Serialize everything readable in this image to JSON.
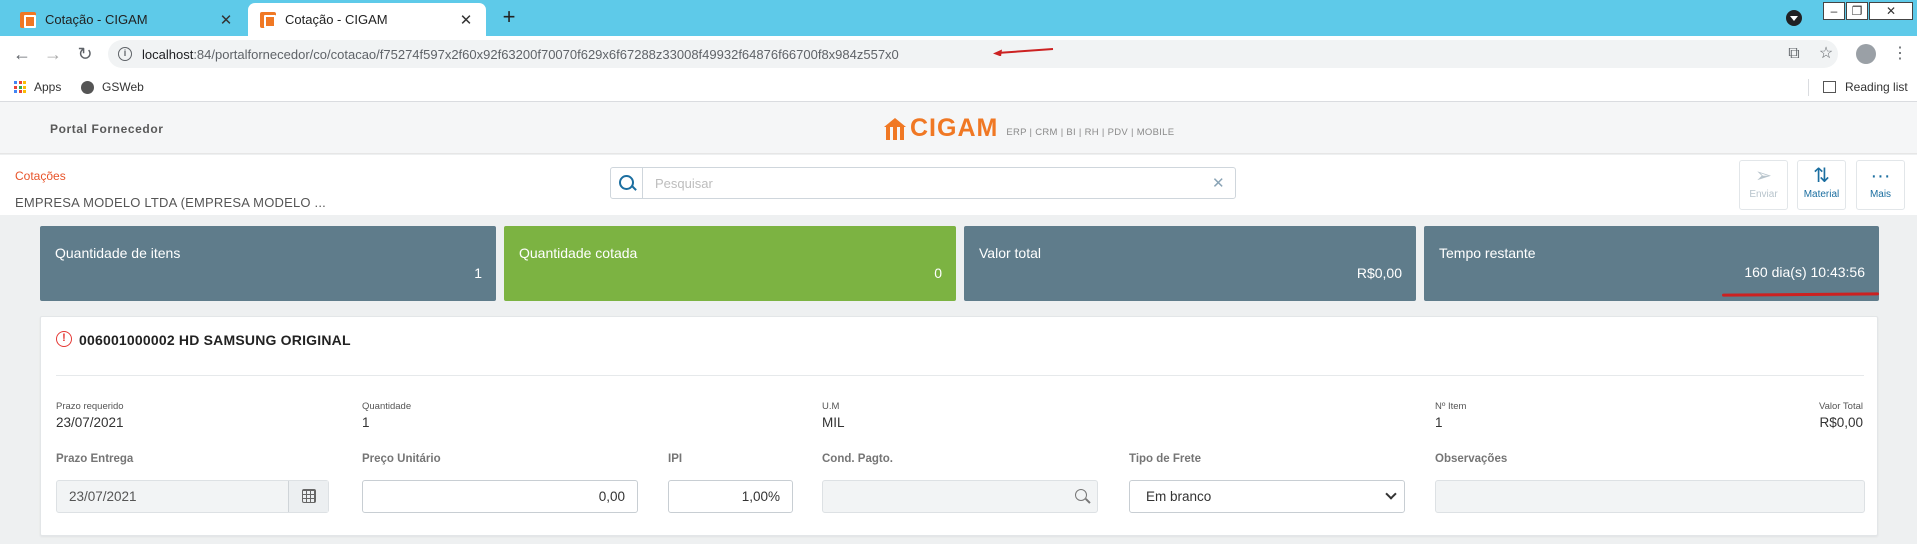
{
  "browser": {
    "tabs": [
      {
        "title": "Cotação - CIGAM",
        "active": false
      },
      {
        "title": "Cotação - CIGAM",
        "active": true
      }
    ],
    "url_host": "localhost",
    "url_path": ":84/portalfornecedor/co/cotacao/f75274f597x2f60x92f63200f70070f629x6f67288z33008f49932f64876f66700f8x984z557x0",
    "bookmarks": {
      "apps": "Apps",
      "gsweb": "GSWeb",
      "reading_list": "Reading list"
    }
  },
  "app": {
    "portal_title": "Portal Fornecedor",
    "brand": "CIGAM",
    "brand_tagline": "ERP | CRM | BI | RH | PDV | MOBILE",
    "accent_color": "#f07824"
  },
  "page": {
    "breadcrumb": "Cotações",
    "company": "EMPRESA MODELO LTDA (EMPRESA MODELO ...",
    "search_placeholder": "Pesquisar",
    "actions": {
      "send": "Enviar",
      "material": "Material",
      "more": "Mais"
    }
  },
  "stats": [
    {
      "title": "Quantidade de itens",
      "value": "1",
      "color": "#5f7c8b"
    },
    {
      "title": "Quantidade cotada",
      "value": "0",
      "color": "#7cb342"
    },
    {
      "title": "Valor total",
      "value": "R$0,00",
      "color": "#5f7c8b"
    },
    {
      "title": "Tempo restante",
      "value": "160 dia(s) 10:43:56",
      "color": "#5f7c8b"
    }
  ],
  "item": {
    "title": "006001000002 HD SAMSUNG ORIGINAL",
    "info": {
      "prazo_requerido_label": "Prazo requerido",
      "prazo_requerido": "23/07/2021",
      "quantidade_label": "Quantidade",
      "quantidade": "1",
      "um_label": "U.M",
      "um": "MIL",
      "n_item_label": "Nº Item",
      "n_item": "1",
      "valor_total_label": "Valor Total",
      "valor_total": "R$0,00"
    },
    "form": {
      "prazo_entrega_label": "Prazo Entrega",
      "prazo_entrega": "23/07/2021",
      "preco_unitario_label": "Preço Unitário",
      "preco_unitario": "0,00",
      "ipi_label": "IPI",
      "ipi": "1,00%",
      "cond_pagto_label": "Cond. Pagto.",
      "cond_pagto": "",
      "tipo_frete_label": "Tipo de Frete",
      "tipo_frete": "Em branco",
      "observacoes_label": "Observações",
      "observacoes": ""
    }
  }
}
